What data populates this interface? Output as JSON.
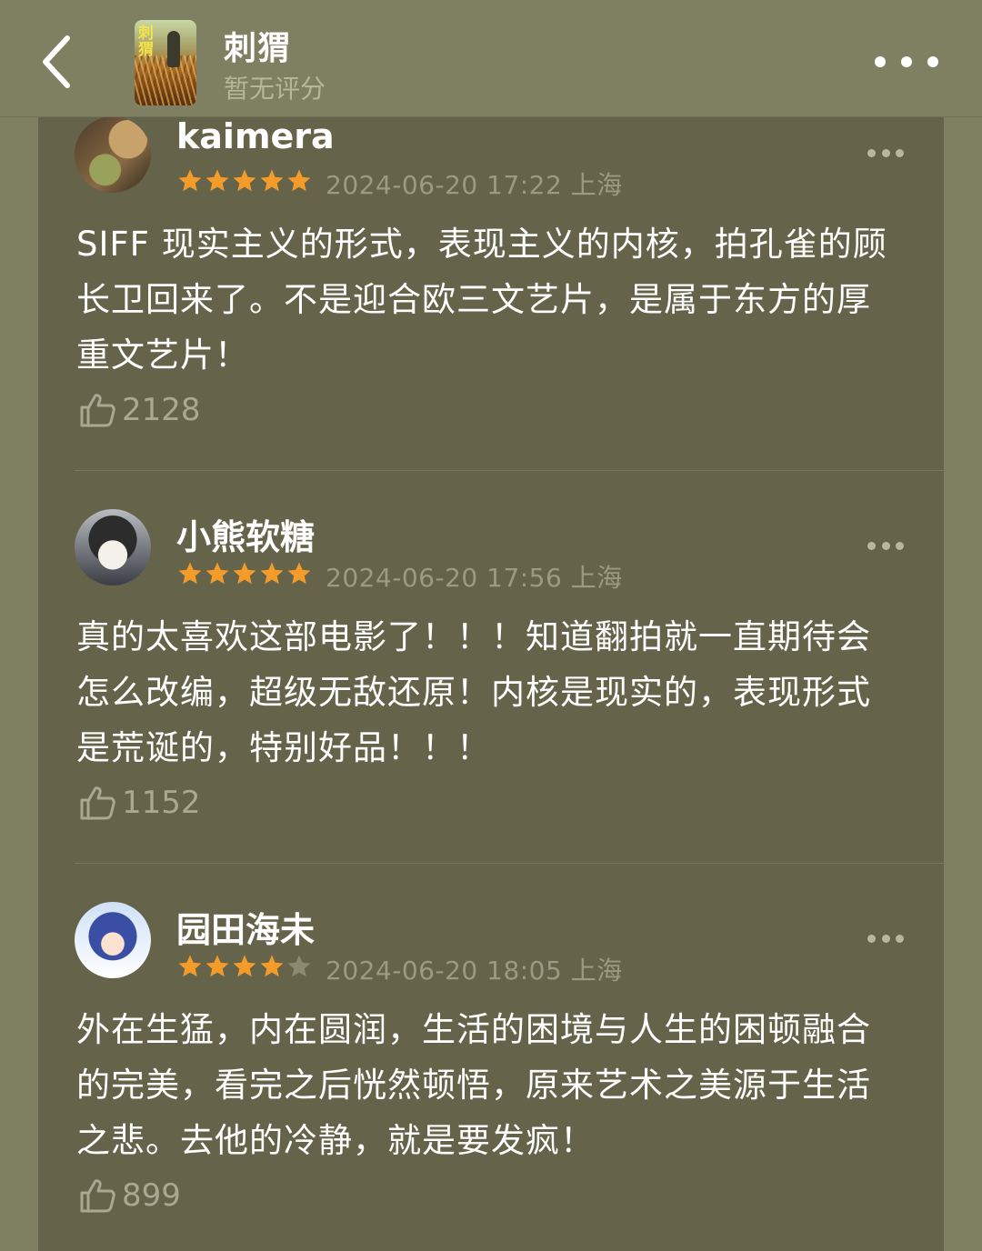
{
  "header": {
    "title": "刺猬",
    "subtitle": "暂无评分",
    "poster_title_glyphs": "刺猬"
  },
  "colors": {
    "background": "#7f7f62",
    "panel": "#65644a",
    "star_on": "#f49b2a",
    "star_off": "#8b8a70"
  },
  "icons": {
    "back": "chevron-left-icon",
    "more": "more-horizontal-icon",
    "like": "thumbs-up-icon"
  },
  "reviews": [
    {
      "username": "kaimera",
      "rating": 5,
      "timestamp": "2024-06-20 17:22",
      "location": "上海",
      "meta": "2024-06-20 17:22 上海",
      "content": "SIFF 现实主义的形式，表现主义的内核，拍孔雀的顾长卫回来了。不是迎合欧三文艺片，是属于东方的厚重文艺片！",
      "likes": "2128"
    },
    {
      "username": "小熊软糖",
      "rating": 5,
      "timestamp": "2024-06-20 17:56",
      "location": "上海",
      "meta": "2024-06-20 17:56 上海",
      "content": "真的太喜欢这部电影了！！！知道翻拍就一直期待会怎么改编，超级无敌还原！内核是现实的，表现形式是荒诞的，特别好品！！！",
      "likes": "1152"
    },
    {
      "username": "园田海未",
      "rating": 4,
      "timestamp": "2024-06-20 18:05",
      "location": "上海",
      "meta": "2024-06-20 18:05 上海",
      "content": "外在生猛，内在圆润，生活的困境与人生的困顿融合的完美，看完之后恍然顿悟，原来艺术之美源于生活之悲。去他的冷静，就是要发疯！",
      "likes": "899"
    }
  ]
}
